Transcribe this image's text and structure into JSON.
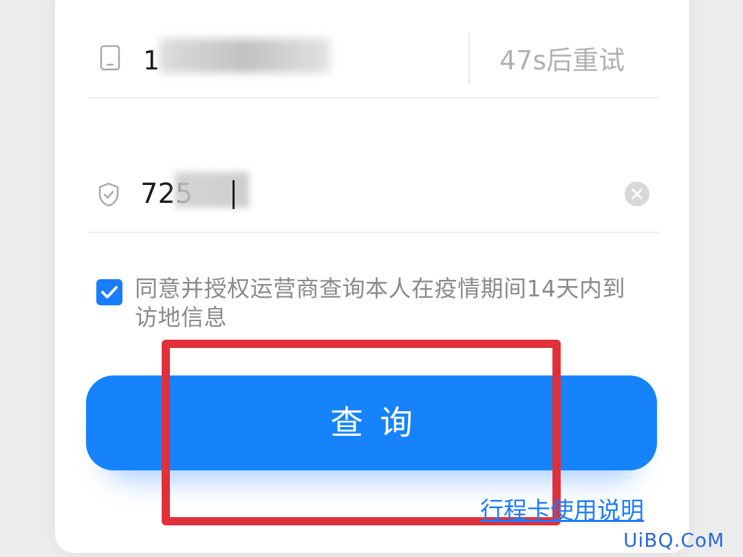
{
  "phone": {
    "icon": "mobile-phone-icon",
    "value": "1",
    "retry_label": "47s后重试"
  },
  "code": {
    "icon": "shield-check-icon",
    "value": "725",
    "clear_icon": "clear-circle-icon"
  },
  "agreement": {
    "checked": true,
    "text": "同意并授权运营商查询本人在疫情期间14天内到访地信息"
  },
  "query_button": {
    "label": "查询"
  },
  "help_link": {
    "label": "行程卡使用说明"
  },
  "watermark": {
    "text": "UiBQ.CoM"
  },
  "colors": {
    "primary": "#1683fb",
    "highlight_box": "#e0303a",
    "muted_text": "#8a8a8a"
  }
}
